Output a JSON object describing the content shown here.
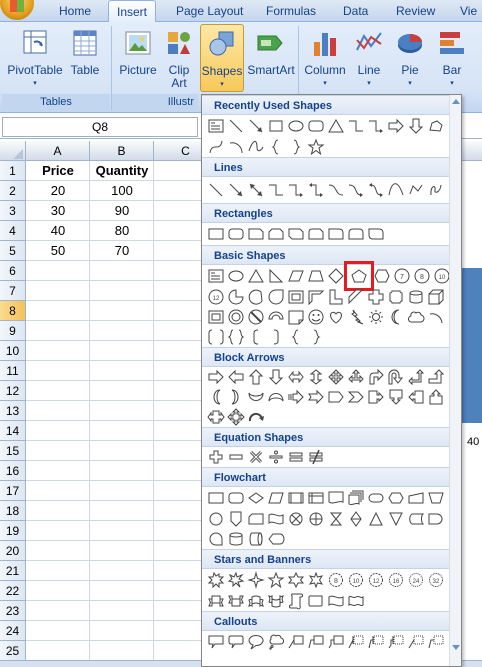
{
  "ribbon": {
    "tabs": [
      {
        "label": "Home"
      },
      {
        "label": "Insert"
      },
      {
        "label": "Page Layout"
      },
      {
        "label": "Formulas"
      },
      {
        "label": "Data"
      },
      {
        "label": "Review"
      },
      {
        "label": "Vie"
      }
    ],
    "active_tab": "Insert",
    "buttons": {
      "pivottable": "PivotTable",
      "table": "Table",
      "picture": "Picture",
      "clipart_1": "Clip",
      "clipart_2": "Art",
      "shapes": "Shapes",
      "smartart": "SmartArt",
      "column": "Column",
      "line": "Line",
      "pie": "Pie",
      "bar": "Bar"
    },
    "groups": {
      "tables": "Tables",
      "illustrations": "Illustr"
    }
  },
  "name_box": "Q8",
  "columns": [
    "A",
    "B",
    "C"
  ],
  "rows": [
    "1",
    "2",
    "3",
    "4",
    "5",
    "6",
    "7",
    "8",
    "9",
    "10",
    "11",
    "12",
    "13",
    "14",
    "15",
    "16",
    "17",
    "18",
    "19",
    "20",
    "21",
    "22",
    "23",
    "24",
    "25"
  ],
  "selected_row": "8",
  "table": {
    "headers": [
      "Price",
      "Quantity"
    ],
    "rows": [
      [
        "20",
        "100"
      ],
      [
        "30",
        "90"
      ],
      [
        "40",
        "80"
      ],
      [
        "50",
        "70"
      ]
    ]
  },
  "chart_peek_value": "40",
  "gallery": {
    "sections": [
      {
        "title": "Recently Used Shapes"
      },
      {
        "title": "Lines"
      },
      {
        "title": "Rectangles"
      },
      {
        "title": "Basic Shapes"
      },
      {
        "title": "Block Arrows"
      },
      {
        "title": "Equation Shapes"
      },
      {
        "title": "Flowchart"
      },
      {
        "title": "Stars and Banners"
      },
      {
        "title": "Callouts"
      }
    ],
    "highlighted_shape": "pentagon-icon",
    "highlight_color": "#e31b23"
  }
}
